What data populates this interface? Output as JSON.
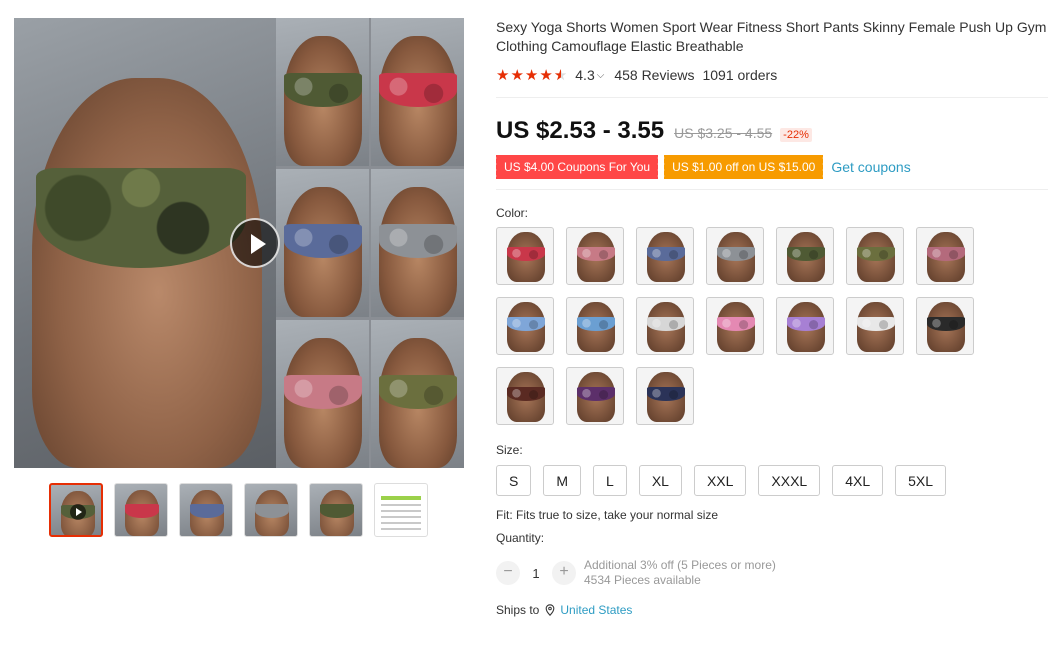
{
  "product": {
    "title": "Sexy Yoga Shorts Women Sport Wear Fitness Short Pants Skinny Female Push Up Gym Clothing Camouflage Elastic Breathable",
    "rating": "4.3",
    "reviews": "458 Reviews",
    "orders": "1091 orders",
    "price": "US $2.53 - 3.55",
    "old_price": "US $3.25 - 4.55",
    "discount": "-22%",
    "coupons": {
      "red": "US $4.00 Coupons For You",
      "orange": "US $1.00 off on US $15.00",
      "get": "Get coupons"
    }
  },
  "color_label": "Color:",
  "colors": [
    {
      "name": "red camo",
      "color": "#c9374a"
    },
    {
      "name": "pink camo",
      "color": "#c77a86"
    },
    {
      "name": "blue camo",
      "color": "#5a6b9a"
    },
    {
      "name": "gray camo",
      "color": "#8d9196"
    },
    {
      "name": "army camo",
      "color": "#4f5a34"
    },
    {
      "name": "olive camo",
      "color": "#6b6f3e"
    },
    {
      "name": "rose camo",
      "color": "#b46a7c"
    },
    {
      "name": "sky blue",
      "color": "#7fa6d8"
    },
    {
      "name": "light blue",
      "color": "#6b9fd2"
    },
    {
      "name": "white camo",
      "color": "#d7d7d7"
    },
    {
      "name": "pink",
      "color": "#e489b3"
    },
    {
      "name": "lavender",
      "color": "#a780d4"
    },
    {
      "name": "white star",
      "color": "#e8e8e8"
    },
    {
      "name": "black dots",
      "color": "#2a2a2a"
    },
    {
      "name": "red dots",
      "color": "#5a2a22"
    },
    {
      "name": "purple dots",
      "color": "#5c2f6a"
    },
    {
      "name": "navy dots",
      "color": "#2b3358"
    }
  ],
  "size_label": "Size:",
  "sizes": [
    "S",
    "M",
    "L",
    "XL",
    "XXL",
    "XXXL",
    "4XL",
    "5XL"
  ],
  "fit": "Fit: Fits true to size, take your normal size",
  "quantity": {
    "label": "Quantity:",
    "value": "1",
    "minus": "−",
    "plus": "+",
    "note1": "Additional 3% off (5 Pieces or more)",
    "note2": "4534 Pieces available"
  },
  "shipping": {
    "label": "Ships to",
    "country": "United States"
  },
  "gallery": {
    "grid_colors": [
      "#4f5a34",
      "#c9374a",
      "#5a6b9a",
      "#8d9196",
      "#c77a86",
      "#6b6f3e"
    ],
    "thumb_colors": [
      "#c9374a",
      "#5a6b9a",
      "#8d9196",
      "#4f5a34"
    ]
  }
}
